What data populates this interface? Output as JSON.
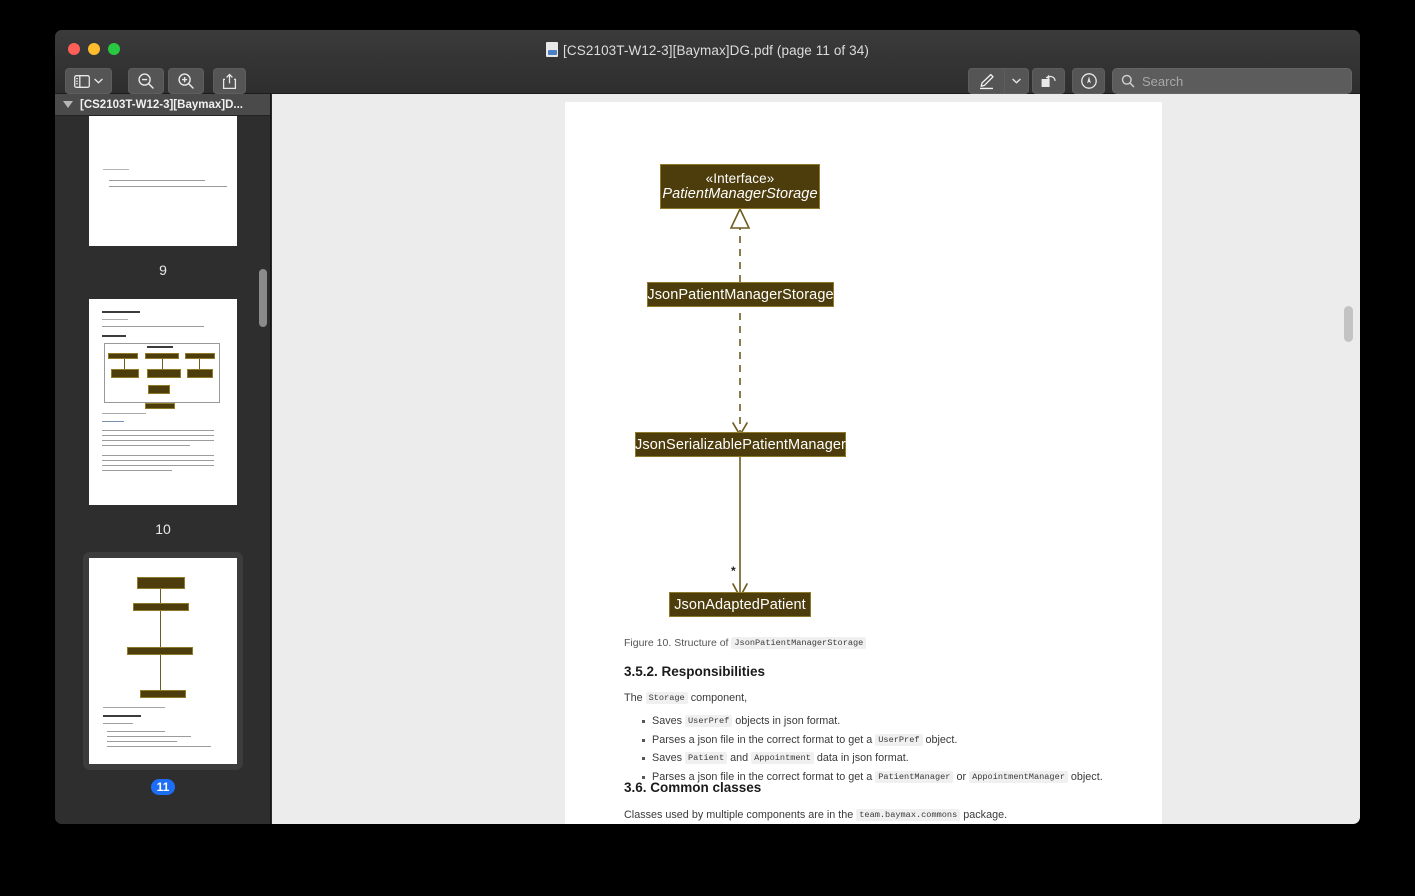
{
  "window": {
    "title": "[CS2103T-W12-3][Baymax]DG.pdf (page 11 of 34)",
    "traffic": {
      "close": "close",
      "minimize": "minimize",
      "maximize": "maximize"
    }
  },
  "toolbar": {
    "sidebar_button": "sidebar-toggle",
    "zoom_out_button": "zoom-out",
    "zoom_in_button": "zoom-in",
    "share_button": "share",
    "markup_button": "markup",
    "markup_menu_button": "markup-options",
    "rotate_button": "rotate-left",
    "annotate_button": "annotate",
    "search_placeholder": "Search",
    "search_value": ""
  },
  "sidebar": {
    "title": "[CS2103T-W12-3][Baymax]D...",
    "thumbnails": [
      {
        "page": "9",
        "selected": false
      },
      {
        "page": "10",
        "selected": false
      },
      {
        "page": "11",
        "selected": true
      }
    ]
  },
  "document": {
    "diagram": {
      "type": "uml-class-diagram",
      "nodes": [
        {
          "id": "iface",
          "stereotype": "«Interface»",
          "name": "PatientManagerStorage",
          "italic": true
        },
        {
          "id": "jpms",
          "name": "JsonPatientManagerStorage"
        },
        {
          "id": "jspm",
          "name": "JsonSerializablePatientManager"
        },
        {
          "id": "jap",
          "name": "JsonAdaptedPatient"
        }
      ],
      "edges": [
        {
          "from": "jpms",
          "to": "iface",
          "kind": "realization",
          "style": "dashed",
          "arrow": "hollow-triangle"
        },
        {
          "from": "jpms",
          "to": "jspm",
          "kind": "dependency",
          "style": "dashed",
          "arrow": "open"
        },
        {
          "from": "jspm",
          "to": "jap",
          "kind": "association",
          "style": "solid",
          "arrow": "open",
          "multiplicity": "*"
        }
      ],
      "colors": {
        "box_fill": "#4d3d0c",
        "box_border": "#8f7a2a",
        "text": "#ffffff"
      }
    },
    "figure_caption_prefix": "Figure 10. Structure of ",
    "figure_caption_code": "JsonPatientManagerStorage",
    "section_352": "3.5.2. Responsibilities",
    "intro_prefix": "The ",
    "intro_code": "Storage",
    "intro_suffix": " component,",
    "bullets": [
      {
        "parts": [
          {
            "t": "text",
            "v": "Saves "
          },
          {
            "t": "code",
            "v": "UserPref"
          },
          {
            "t": "text",
            "v": " objects in json format."
          }
        ]
      },
      {
        "parts": [
          {
            "t": "text",
            "v": "Parses a json file in the correct format to get a "
          },
          {
            "t": "code",
            "v": "UserPref"
          },
          {
            "t": "text",
            "v": " object."
          }
        ]
      },
      {
        "parts": [
          {
            "t": "text",
            "v": "Saves "
          },
          {
            "t": "code",
            "v": "Patient"
          },
          {
            "t": "text",
            "v": " and "
          },
          {
            "t": "code",
            "v": "Appointment"
          },
          {
            "t": "text",
            "v": " data in json format."
          }
        ]
      },
      {
        "parts": [
          {
            "t": "text",
            "v": "Parses a json file in the correct format to get a "
          },
          {
            "t": "code",
            "v": "PatientManager"
          },
          {
            "t": "text",
            "v": " or "
          },
          {
            "t": "code",
            "v": "AppointmentManager"
          },
          {
            "t": "text",
            "v": " object."
          }
        ]
      }
    ],
    "section_36": "3.6. Common classes",
    "closing_prefix": "Classes used by multiple components are in the ",
    "closing_code": "team.baymax.commons",
    "closing_suffix": " package."
  }
}
